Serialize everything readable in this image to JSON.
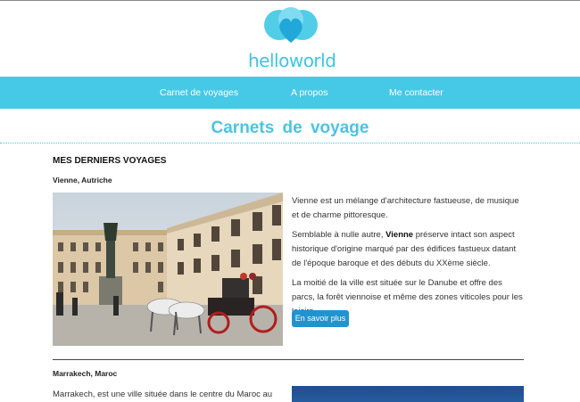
{
  "brand": {
    "logo_text": "helloworld",
    "accent": "#46c9e6"
  },
  "nav": {
    "items": [
      "Carnet de voyages",
      "A propos",
      "Me contacter"
    ]
  },
  "page": {
    "title": "Carnets de voyage"
  },
  "section": {
    "heading": "MES DERNIERS VOYAGES"
  },
  "articles": [
    {
      "place": "Vienne, Autriche",
      "photo_icon": "vienna-photo",
      "p1": "Vienne est un mélange d'architecture fastueuse, de musique et de charme pittoresque.",
      "p2_before": "Semblable à nulle autre,",
      "p2_bold": "Vienne",
      "p2_after": "préserve intact son aspect historique d'origine marqué par des édifices fastueux datant de l'époque baroque et des débuts du XXème siècle.",
      "p3": "La moitié de la ville est située sur le Danube et offre des parcs, la forêt viennoise et même des zones viticoles pour les loisirs.",
      "button": "En savoir plus"
    },
    {
      "place": "Marrakech, Maroc",
      "p1": "Marrakech, est une ville située dans le centre du Maroc au pied"
    }
  ]
}
